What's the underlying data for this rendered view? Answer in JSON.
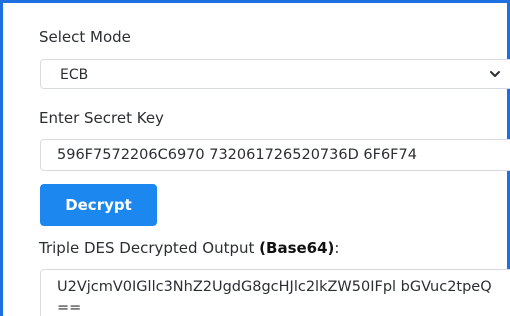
{
  "mode": {
    "label": "Select Mode",
    "selected": "ECB"
  },
  "key": {
    "label": "Enter Secret Key",
    "value": "596F7572206C6970 732061726520736D 6F6F74"
  },
  "decrypt_button": {
    "label": "Decrypt"
  },
  "output": {
    "label_prefix": "Triple DES Decrypted Output ",
    "label_format": "(Base64)",
    "label_suffix": ":",
    "value": "U2VjcmV0IGllc3NhZ2UgdG8gcHJlc2lkZW50IFpl bGVuc2tpeQ=="
  },
  "accent_color": "#1c87ee"
}
